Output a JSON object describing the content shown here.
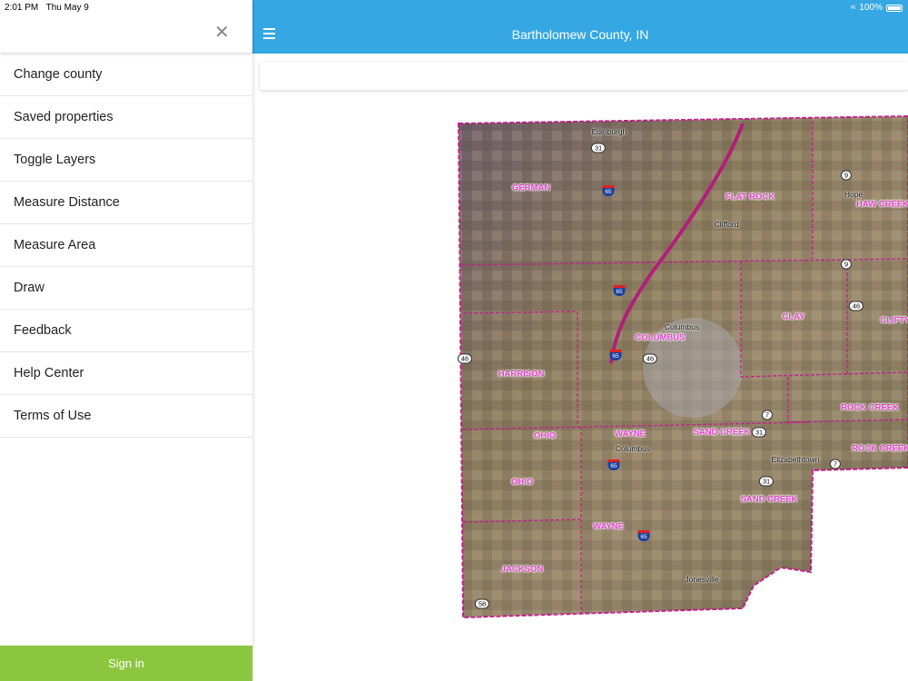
{
  "status": {
    "time": "2:01 PM",
    "date": "Thu May 9",
    "battery": "100%"
  },
  "header": {
    "title": "Bartholomew County, IN"
  },
  "drawer": {
    "items": [
      "Change county",
      "Saved properties",
      "Toggle Layers",
      "Measure Distance",
      "Measure Area",
      "Draw",
      "Feedback",
      "Help Center",
      "Terms of Use"
    ],
    "sign_in": "Sign in"
  },
  "colors": {
    "header": "#35a8e4",
    "sign_in": "#8cc63e",
    "township_label": "#e040c8"
  },
  "map": {
    "townships": [
      "GERMAN",
      "FLAT ROCK",
      "HAW CREEK",
      "CLAY",
      "CLIFTY",
      "COLUMBUS",
      "HARRISON",
      "ROCK CREEK",
      "ROCK CREEK",
      "OHIO",
      "WAYNE",
      "SAND CREEK",
      "OHIO",
      "SAND CREEK",
      "WAYNE",
      "JACKSON"
    ],
    "towns": [
      "Edinburgh",
      "Hope",
      "Clifford",
      "Columbus",
      "Columbus",
      "Elizabethtown",
      "Jonesville"
    ],
    "routes": [
      "31",
      "9",
      "9",
      "46",
      "46",
      "46",
      "7",
      "31",
      "7",
      "31",
      "58"
    ],
    "interstates": [
      "65",
      "65",
      "65",
      "65",
      "65"
    ]
  }
}
